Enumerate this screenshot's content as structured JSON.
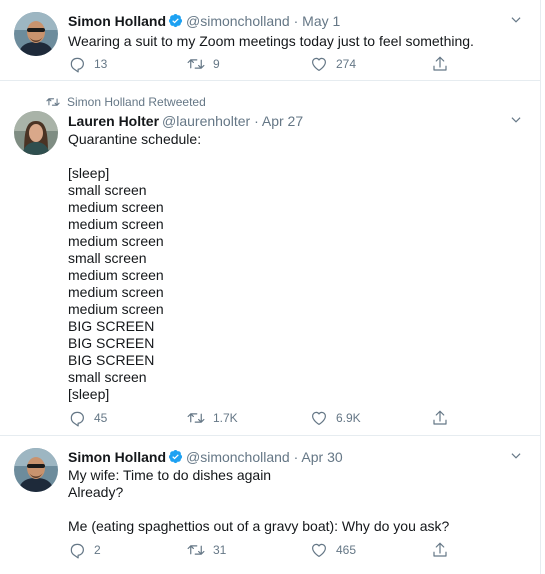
{
  "tweets": [
    {
      "author": "Simon Holland",
      "handle": "@simoncholland",
      "date": "May 1",
      "text": "Wearing a suit to my Zoom meetings today just to feel something.",
      "replies": "13",
      "retweets": "9",
      "likes": "274"
    },
    {
      "retweeted_by": "Simon Holland Retweeted",
      "author": "Lauren Holter",
      "handle": "@laurenholter",
      "date": "Apr 27",
      "text": "Quarantine schedule:\n\n[sleep]\nsmall screen\nmedium screen\nmedium screen\nmedium screen\nsmall screen\nmedium screen\nmedium screen\nmedium screen\nBIG SCREEN\nBIG SCREEN\nBIG SCREEN\nsmall screen\n[sleep]",
      "replies": "45",
      "retweets": "1.7K",
      "likes": "6.9K"
    },
    {
      "author": "Simon Holland",
      "handle": "@simoncholland",
      "date": "Apr 30",
      "text": "My wife: Time to do dishes again\nAlready?\n\nMe (eating spaghettios out of a gravy boat): Why do you ask?",
      "replies": "2",
      "retweets": "31",
      "likes": "465"
    }
  ],
  "separator": "·",
  "icons": {
    "verified": "verified-badge-icon",
    "caret": "chevron-down-icon",
    "reply": "reply-icon",
    "retweet": "retweet-icon",
    "like": "heart-icon",
    "share": "share-icon"
  },
  "colors": {
    "accent": "#1da1f2",
    "muted": "#657786",
    "text": "#14171a",
    "border": "#e6ecf0"
  }
}
